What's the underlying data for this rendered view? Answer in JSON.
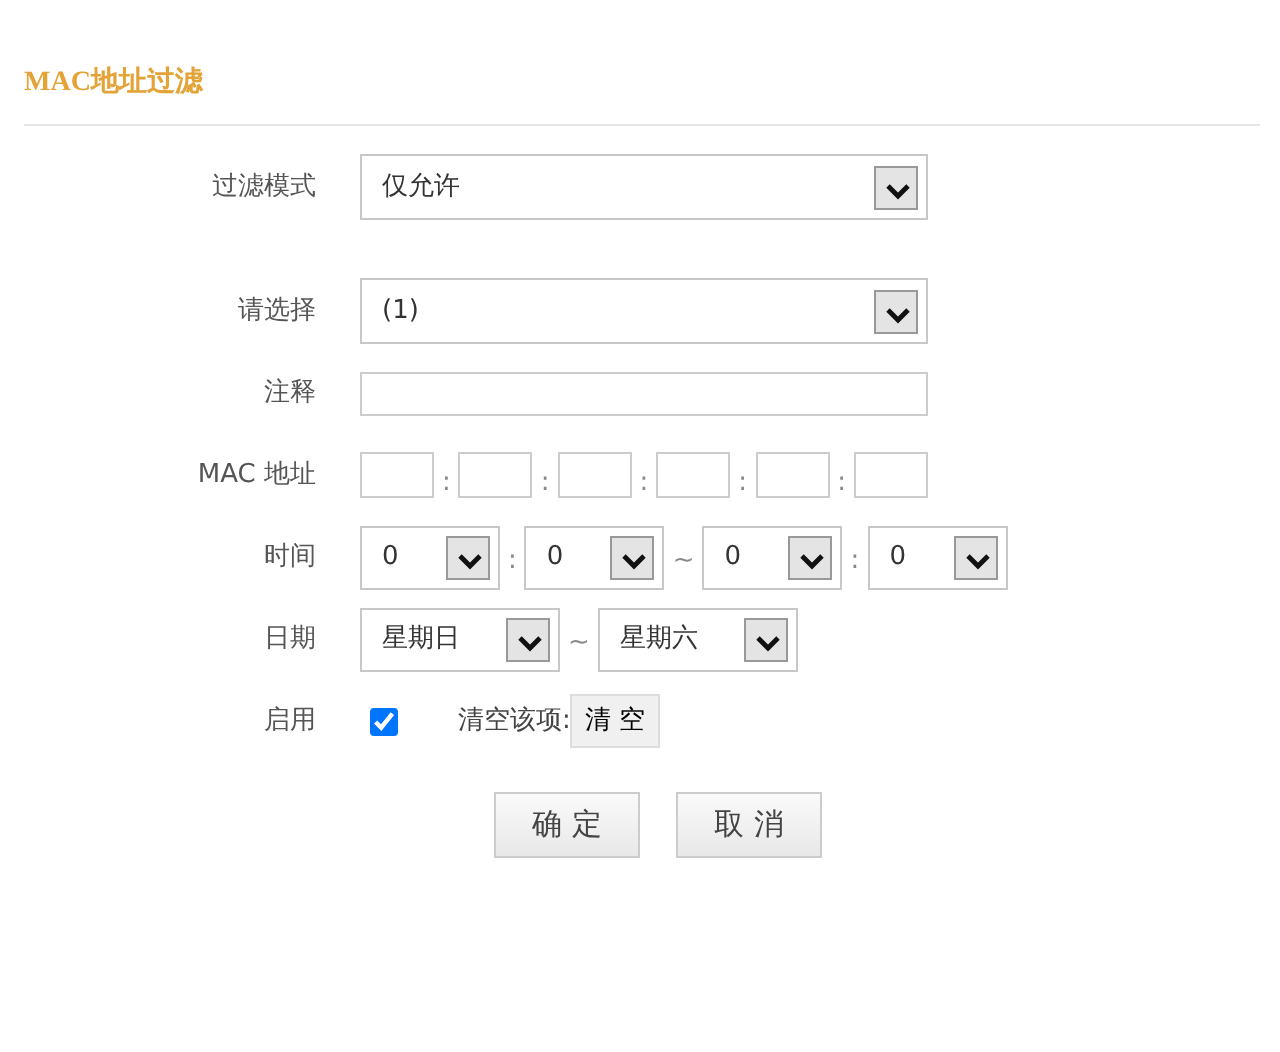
{
  "section_title": "MAC地址过滤",
  "rows": [
    {
      "label": "过滤模式",
      "items": [
        {
          "kind": "dropdown-wide",
          "value": "仅允许"
        }
      ]
    },
    {
      "label": "请选择",
      "items": [
        {
          "kind": "dropdown-wide",
          "value": "(1)"
        }
      ]
    },
    {
      "label": "注释",
      "items": [
        {
          "kind": "input-wide"
        }
      ]
    },
    {
      "label": "MAC 地址",
      "items": [
        {
          "kind": "input-octet"
        },
        {
          "kind": "sep",
          "text": ":"
        },
        {
          "kind": "input-octet"
        },
        {
          "kind": "sep",
          "text": ":"
        },
        {
          "kind": "input-octet"
        },
        {
          "kind": "sep",
          "text": ":"
        },
        {
          "kind": "input-octet"
        },
        {
          "kind": "sep",
          "text": ":"
        },
        {
          "kind": "input-octet"
        },
        {
          "kind": "sep",
          "text": ":"
        },
        {
          "kind": "input-octet"
        }
      ]
    },
    {
      "label": "时间",
      "items": [
        {
          "kind": "dropdown-time",
          "value": "0"
        },
        {
          "kind": "sep",
          "text": ":"
        },
        {
          "kind": "dropdown-time",
          "value": "0"
        },
        {
          "kind": "sep",
          "text": "~"
        },
        {
          "kind": "dropdown-time",
          "value": "0"
        },
        {
          "kind": "sep",
          "text": ":"
        },
        {
          "kind": "dropdown-time",
          "value": "0"
        }
      ]
    },
    {
      "label": "日期",
      "items": [
        {
          "kind": "dropdown-day",
          "value": "星期日"
        },
        {
          "kind": "sep",
          "text": "~"
        },
        {
          "kind": "dropdown-day",
          "value": "星期六"
        }
      ]
    },
    {
      "label": "启用",
      "items": [
        {
          "kind": "checkbox",
          "checked": true
        },
        {
          "kind": "text",
          "text": "清空该项:"
        },
        {
          "kind": "button",
          "text": "清 空"
        }
      ]
    }
  ],
  "buttons": [
    "确 定",
    "取 消"
  ]
}
